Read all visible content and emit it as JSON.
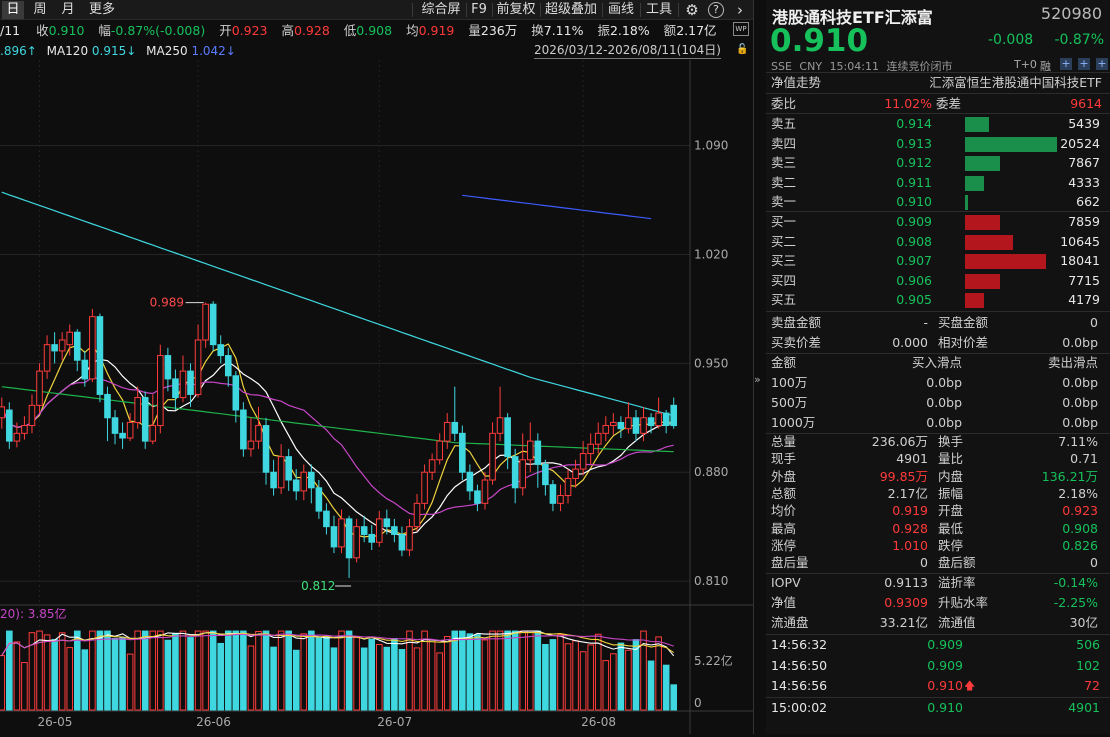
{
  "toolbar": {
    "period_tabs": [
      "日",
      "周",
      "月",
      "更多"
    ],
    "tools": [
      "综合屏",
      "F9",
      "前复权",
      "超级叠加",
      "画线",
      "工具"
    ]
  },
  "quote_line": {
    "date": "/11",
    "close_label": "收",
    "close": "0.910",
    "chg_label": "幅",
    "chg": "-0.87%(-0.008)",
    "open_label": "开",
    "open": "0.923",
    "high_label": "高",
    "high": "0.928",
    "low_label": "低",
    "low": "0.908",
    "avg_label": "均",
    "avg": "0.919",
    "vol_label": "量",
    "vol": "236万",
    "turn_label": "换",
    "turn": "7.11%",
    "amp_label": "振",
    "amp": "2.18%",
    "amt_label": "额",
    "amt": "2.17亿"
  },
  "ma_line": {
    "ma_prev": ".896↑",
    "ma120_label": "MA120",
    "ma120": "0.915↓",
    "ma250_label": "MA250",
    "ma250": "1.042↓"
  },
  "date_range": "2026/03/12-2026/08/11(104日)",
  "chart_data": {
    "type": "candlestick",
    "y_ticks": [
      "1.090",
      "1.020",
      "0.950",
      "0.880",
      "0.810"
    ],
    "y_tick_values": [
      1.09,
      1.02,
      0.95,
      0.88,
      0.81
    ],
    "x_ticks": [
      "26-05",
      "26-06",
      "26-07",
      "26-08"
    ],
    "x_tick_index": [
      5,
      26,
      50,
      77
    ],
    "annotations": {
      "high": "0.989",
      "low": "0.812",
      "high_index": 27,
      "low_index": 46
    },
    "candles": [
      [
        0.915,
        0.922,
        0.928,
        0.908
      ],
      [
        0.92,
        0.9,
        0.925,
        0.895
      ],
      [
        0.9,
        0.905,
        0.912,
        0.896
      ],
      [
        0.905,
        0.91,
        0.916,
        0.901
      ],
      [
        0.91,
        0.923,
        0.93,
        0.905
      ],
      [
        0.923,
        0.945,
        0.95,
        0.918
      ],
      [
        0.945,
        0.962,
        0.968,
        0.94
      ],
      [
        0.962,
        0.958,
        0.97,
        0.95
      ],
      [
        0.958,
        0.965,
        0.97,
        0.952
      ],
      [
        0.962,
        0.97,
        0.975,
        0.955
      ],
      [
        0.97,
        0.952,
        0.972,
        0.945
      ],
      [
        0.952,
        0.94,
        0.958,
        0.935
      ],
      [
        0.94,
        0.98,
        0.985,
        0.938
      ],
      [
        0.98,
        0.93,
        0.982,
        0.925
      ],
      [
        0.93,
        0.915,
        0.935,
        0.9
      ],
      [
        0.915,
        0.905,
        0.92,
        0.898
      ],
      [
        0.905,
        0.902,
        0.912,
        0.895
      ],
      [
        0.902,
        0.912,
        0.918,
        0.9
      ],
      [
        0.912,
        0.928,
        0.935,
        0.908
      ],
      [
        0.928,
        0.9,
        0.932,
        0.895
      ],
      [
        0.9,
        0.91,
        0.93,
        0.898
      ],
      [
        0.91,
        0.955,
        0.962,
        0.905
      ],
      [
        0.955,
        0.94,
        0.96,
        0.932
      ],
      [
        0.94,
        0.928,
        0.946,
        0.92
      ],
      [
        0.928,
        0.945,
        0.955,
        0.925
      ],
      [
        0.945,
        0.93,
        0.95,
        0.922
      ],
      [
        0.93,
        0.965,
        0.975,
        0.928
      ],
      [
        0.965,
        0.988,
        0.989,
        0.96
      ],
      [
        0.988,
        0.962,
        0.99,
        0.958
      ],
      [
        0.962,
        0.955,
        0.968,
        0.95
      ],
      [
        0.955,
        0.942,
        0.96,
        0.935
      ],
      [
        0.942,
        0.92,
        0.945,
        0.912
      ],
      [
        0.92,
        0.895,
        0.925,
        0.89
      ],
      [
        0.895,
        0.9,
        0.915,
        0.89
      ],
      [
        0.9,
        0.91,
        0.922,
        0.895
      ],
      [
        0.91,
        0.88,
        0.915,
        0.872
      ],
      [
        0.88,
        0.87,
        0.888,
        0.865
      ],
      [
        0.87,
        0.89,
        0.898,
        0.866
      ],
      [
        0.89,
        0.875,
        0.895,
        0.868
      ],
      [
        0.875,
        0.868,
        0.882,
        0.862
      ],
      [
        0.868,
        0.88,
        0.885,
        0.862
      ],
      [
        0.88,
        0.87,
        0.885,
        0.86
      ],
      [
        0.87,
        0.855,
        0.875,
        0.85
      ],
      [
        0.855,
        0.845,
        0.86,
        0.84
      ],
      [
        0.845,
        0.832,
        0.852,
        0.828
      ],
      [
        0.832,
        0.85,
        0.856,
        0.828
      ],
      [
        0.85,
        0.825,
        0.852,
        0.812
      ],
      [
        0.825,
        0.845,
        0.85,
        0.822
      ],
      [
        0.845,
        0.84,
        0.852,
        0.835
      ],
      [
        0.84,
        0.835,
        0.846,
        0.83
      ],
      [
        0.835,
        0.85,
        0.855,
        0.832
      ],
      [
        0.85,
        0.845,
        0.856,
        0.84
      ],
      [
        0.845,
        0.84,
        0.85,
        0.835
      ],
      [
        0.84,
        0.83,
        0.845,
        0.826
      ],
      [
        0.83,
        0.845,
        0.85,
        0.826
      ],
      [
        0.845,
        0.86,
        0.866,
        0.842
      ],
      [
        0.86,
        0.88,
        0.885,
        0.856
      ],
      [
        0.88,
        0.888,
        0.892,
        0.875
      ],
      [
        0.888,
        0.9,
        0.905,
        0.885
      ],
      [
        0.9,
        0.912,
        0.918,
        0.895
      ],
      [
        0.912,
        0.905,
        0.935,
        0.9
      ],
      [
        0.905,
        0.88,
        0.91,
        0.875
      ],
      [
        0.88,
        0.868,
        0.885,
        0.862
      ],
      [
        0.868,
        0.86,
        0.872,
        0.855
      ],
      [
        0.86,
        0.875,
        0.88,
        0.856
      ],
      [
        0.875,
        0.905,
        0.912,
        0.872
      ],
      [
        0.905,
        0.915,
        0.935,
        0.9
      ],
      [
        0.915,
        0.89,
        0.918,
        0.882
      ],
      [
        0.89,
        0.87,
        0.895,
        0.86
      ],
      [
        0.87,
        0.888,
        0.905,
        0.865
      ],
      [
        0.888,
        0.9,
        0.912,
        0.88
      ],
      [
        0.9,
        0.885,
        0.905,
        0.87
      ],
      [
        0.885,
        0.872,
        0.888,
        0.865
      ],
      [
        0.872,
        0.86,
        0.875,
        0.855
      ],
      [
        0.86,
        0.865,
        0.872,
        0.855
      ],
      [
        0.865,
        0.876,
        0.882,
        0.86
      ],
      [
        0.876,
        0.882,
        0.888,
        0.87
      ],
      [
        0.882,
        0.892,
        0.9,
        0.878
      ],
      [
        0.892,
        0.898,
        0.905,
        0.885
      ],
      [
        0.898,
        0.905,
        0.912,
        0.892
      ],
      [
        0.905,
        0.91,
        0.916,
        0.9
      ],
      [
        0.91,
        0.912,
        0.918,
        0.904
      ],
      [
        0.912,
        0.908,
        0.916,
        0.902
      ],
      [
        0.908,
        0.915,
        0.925,
        0.905
      ],
      [
        0.915,
        0.905,
        0.92,
        0.9
      ],
      [
        0.905,
        0.915,
        0.922,
        0.9
      ],
      [
        0.915,
        0.91,
        0.918,
        0.905
      ],
      [
        0.91,
        0.918,
        0.928,
        0.908
      ],
      [
        0.918,
        0.91,
        0.92,
        0.905
      ],
      [
        0.923,
        0.91,
        0.928,
        0.908
      ]
    ],
    "volume_tick": "5.22亿",
    "volume_zero": "0",
    "volume_label": "20): 3.85亿",
    "volume_max": 7.5
  },
  "panel": {
    "title": "港股通科技ETF汇添富",
    "code": "520980",
    "price": "0.910",
    "chg": "-0.008",
    "chg_pct": "-0.87%",
    "market": "SSE",
    "currency": "CNY",
    "time": "15:04:11",
    "status": "连续竞价闭市",
    "t0": "T+0",
    "rong": "融",
    "nav_trend": "净值走势",
    "fund_name": "汇添富恒生港股通中国科技ETF",
    "wb_label": "委比",
    "wb": "11.02%",
    "wc_label": "委差",
    "wc": "9614",
    "asks": [
      {
        "label": "卖五",
        "price": "0.914",
        "vol": "5439",
        "ratio": 0.265
      },
      {
        "label": "卖四",
        "price": "0.913",
        "vol": "20524",
        "ratio": 1.0
      },
      {
        "label": "卖三",
        "price": "0.912",
        "vol": "7867",
        "ratio": 0.383
      },
      {
        "label": "卖二",
        "price": "0.911",
        "vol": "4333",
        "ratio": 0.211
      },
      {
        "label": "卖一",
        "price": "0.910",
        "vol": "662",
        "ratio": 0.032
      }
    ],
    "bids": [
      {
        "label": "买一",
        "price": "0.909",
        "vol": "7859",
        "ratio": 0.383
      },
      {
        "label": "买二",
        "price": "0.908",
        "vol": "10645",
        "ratio": 0.519
      },
      {
        "label": "买三",
        "price": "0.907",
        "vol": "18041",
        "ratio": 0.879
      },
      {
        "label": "买四",
        "price": "0.906",
        "vol": "7715",
        "ratio": 0.376
      },
      {
        "label": "买五",
        "price": "0.905",
        "vol": "4179",
        "ratio": 0.204
      }
    ],
    "sell_amt_label": "卖盘金额",
    "sell_amt": "-",
    "buy_amt_label": "买盘金额",
    "buy_amt": "0",
    "spread_label": "买卖价差",
    "spread": "0.000",
    "rel_spread_label": "相对价差",
    "rel_spread": "0.0bp",
    "slip_head": [
      "金额",
      "买入滑点",
      "卖出滑点"
    ],
    "slips": [
      [
        "100万",
        "0.0bp",
        "0.0bp"
      ],
      [
        "500万",
        "0.0bp",
        "0.0bp"
      ],
      [
        "1000万",
        "0.0bp",
        "0.0bp"
      ]
    ],
    "stats": [
      [
        [
          "总量",
          "236.06万",
          ""
        ],
        [
          "换手",
          "7.11%",
          ""
        ]
      ],
      [
        [
          "现手",
          "4901",
          ""
        ],
        [
          "量比",
          "0.71",
          ""
        ]
      ],
      [
        [
          "外盘",
          "99.85万",
          "red"
        ],
        [
          "内盘",
          "136.21万",
          "grn"
        ]
      ],
      [
        [
          "总额",
          "2.17亿",
          ""
        ],
        [
          "振幅",
          "2.18%",
          ""
        ]
      ],
      [
        [
          "均价",
          "0.919",
          "red"
        ],
        [
          "开盘",
          "0.923",
          "red"
        ]
      ],
      [
        [
          "最高",
          "0.928",
          "red"
        ],
        [
          "最低",
          "0.908",
          "grn"
        ]
      ],
      [
        [
          "涨停",
          "1.010",
          "red"
        ],
        [
          "跌停",
          "0.826",
          "grn"
        ]
      ],
      [
        [
          "盘后量",
          "0",
          ""
        ],
        [
          "盘后额",
          "0",
          ""
        ]
      ]
    ],
    "iopv": [
      [
        [
          "IOPV",
          "0.9113",
          ""
        ],
        [
          "溢折率",
          "-0.14%",
          "grn"
        ]
      ],
      [
        [
          "净值",
          "0.9309",
          "red"
        ],
        [
          "升贴水率",
          "-2.25%",
          "grn"
        ]
      ],
      [
        [
          "流通盘",
          "33.21亿",
          ""
        ],
        [
          "流通值",
          "30亿",
          ""
        ]
      ]
    ],
    "ticks": [
      {
        "time": "14:56:32",
        "price": "0.909",
        "vol": "506",
        "arrow": "",
        "color": "grn"
      },
      {
        "time": "14:56:50",
        "price": "0.909",
        "vol": "102",
        "arrow": "",
        "color": "grn"
      },
      {
        "time": "14:56:56",
        "price": "0.910",
        "vol": "72",
        "arrow": "🡅",
        "color": "red"
      },
      {
        "time": "15:00:02",
        "price": "0.910",
        "vol": "4901",
        "arrow": "",
        "color": "grn"
      }
    ]
  },
  "icons": {
    "settings": "⚙",
    "help": "?",
    "more": "›"
  }
}
